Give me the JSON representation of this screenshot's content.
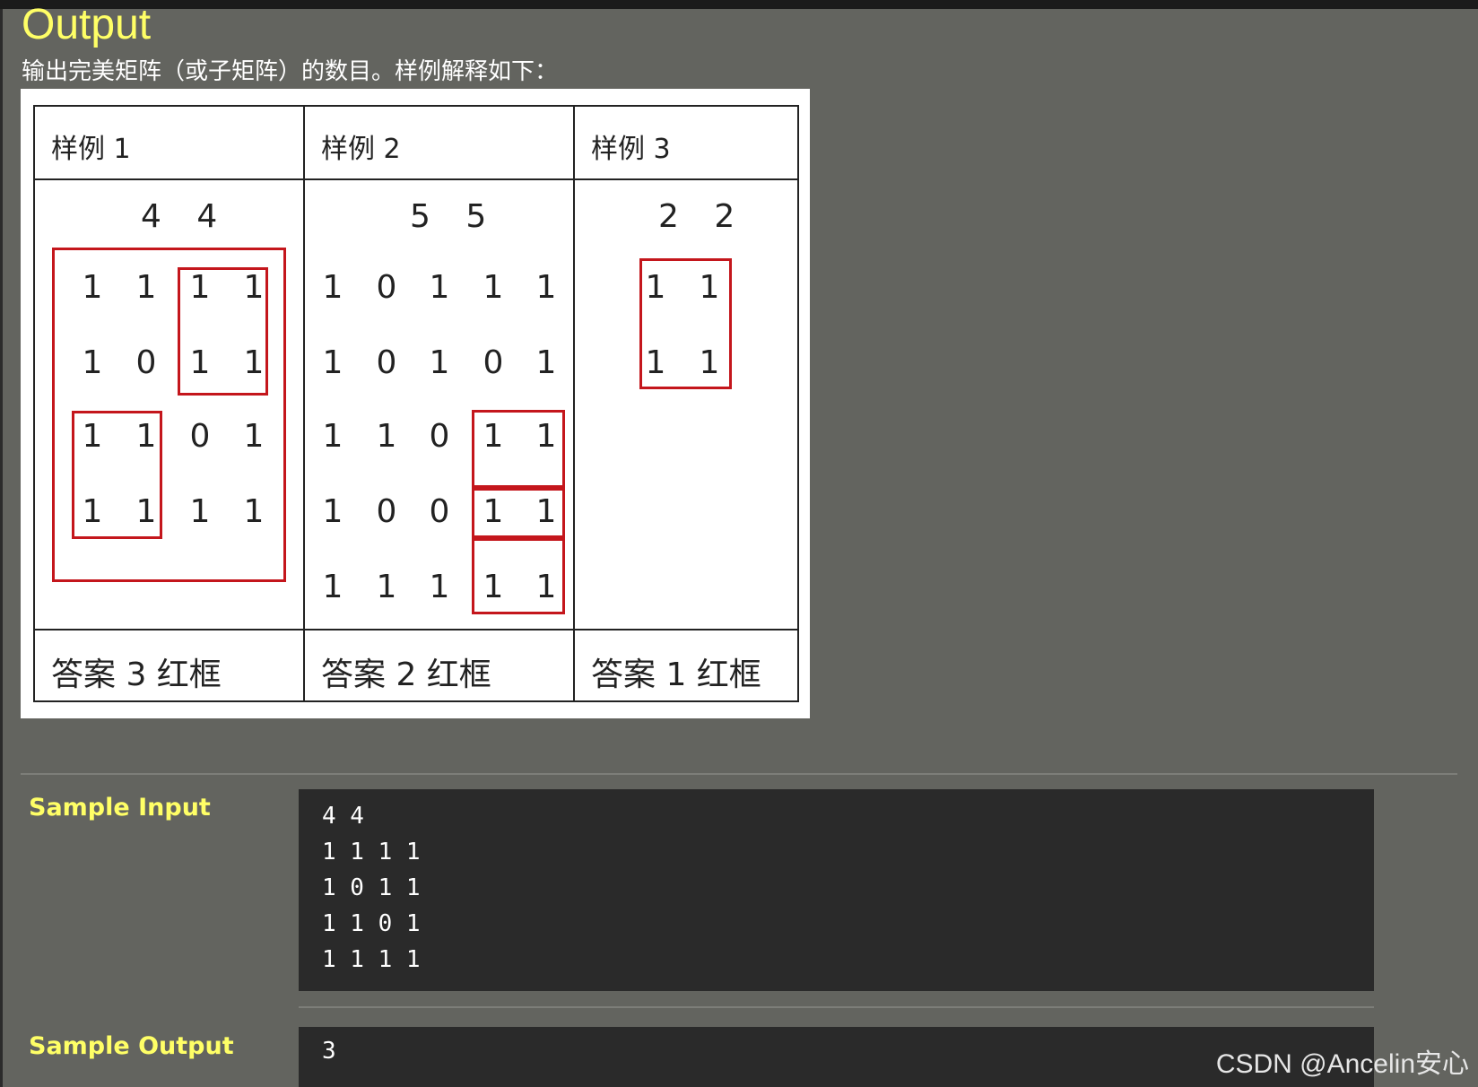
{
  "output_section": {
    "heading": "Output",
    "description": "输出完美矩阵（或子矩阵）的数目。样例解释如下："
  },
  "figure": {
    "samples": [
      {
        "header": "样例 1",
        "dims": "4 4",
        "grid": [
          [
            "1",
            "1",
            "1",
            "1"
          ],
          [
            "1",
            "0",
            "1",
            "1"
          ],
          [
            "1",
            "1",
            "0",
            "1"
          ],
          [
            "1",
            "1",
            "1",
            "1"
          ]
        ],
        "answer": "答案 3 红框"
      },
      {
        "header": "样例 2",
        "dims": "5 5",
        "grid": [
          [
            "1",
            "0",
            "1",
            "1",
            "1"
          ],
          [
            "1",
            "0",
            "1",
            "0",
            "1"
          ],
          [
            "1",
            "1",
            "0",
            "1",
            "1"
          ],
          [
            "1",
            "0",
            "0",
            "1",
            "1"
          ],
          [
            "1",
            "1",
            "1",
            "1",
            "1"
          ]
        ],
        "answer": "答案 2 红框"
      },
      {
        "header": "样例 3",
        "dims": "2 2",
        "grid": [
          [
            "1",
            "1"
          ],
          [
            "1",
            "1"
          ]
        ],
        "answer": "答案 1 红框"
      }
    ]
  },
  "sample_input": {
    "label": "Sample Input",
    "lines": [
      "4 4",
      "1 1 1 1",
      "1 0 1 1",
      "1 1 0 1",
      "1 1 1 1"
    ]
  },
  "sample_output": {
    "label": "Sample Output",
    "value": "3"
  },
  "watermark": "CSDN @Ancelin安心",
  "colors": {
    "background": "#63645f",
    "heading": "#ffff66",
    "code_background": "#2a2a2a",
    "red_box": "#c4161c"
  }
}
